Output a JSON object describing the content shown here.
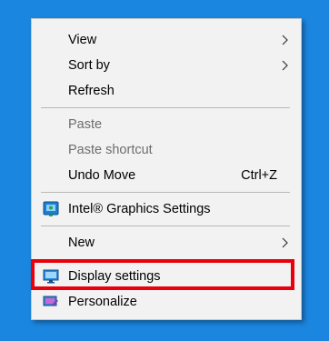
{
  "menu": {
    "items": [
      {
        "label": "View",
        "icon": "",
        "submenu": true
      },
      {
        "label": "Sort by",
        "icon": "",
        "submenu": true
      },
      {
        "label": "Refresh",
        "icon": ""
      },
      {
        "label": "Paste",
        "icon": "",
        "disabled": true
      },
      {
        "label": "Paste shortcut",
        "icon": "",
        "disabled": true
      },
      {
        "label": "Undo Move",
        "icon": "",
        "shortcut": "Ctrl+Z"
      },
      {
        "label": "Intel® Graphics Settings",
        "icon": "intel-graphics-icon"
      },
      {
        "label": "New",
        "icon": "",
        "submenu": true
      },
      {
        "label": "Display settings",
        "icon": "display-monitor-icon"
      },
      {
        "label": "Personalize",
        "icon": "personalize-icon"
      }
    ]
  },
  "colors": {
    "desktop_background": "#1b86e0",
    "menu_background": "#f2f2f2",
    "highlight_border": "#e8000b",
    "disabled_text": "#6d6d6d"
  }
}
